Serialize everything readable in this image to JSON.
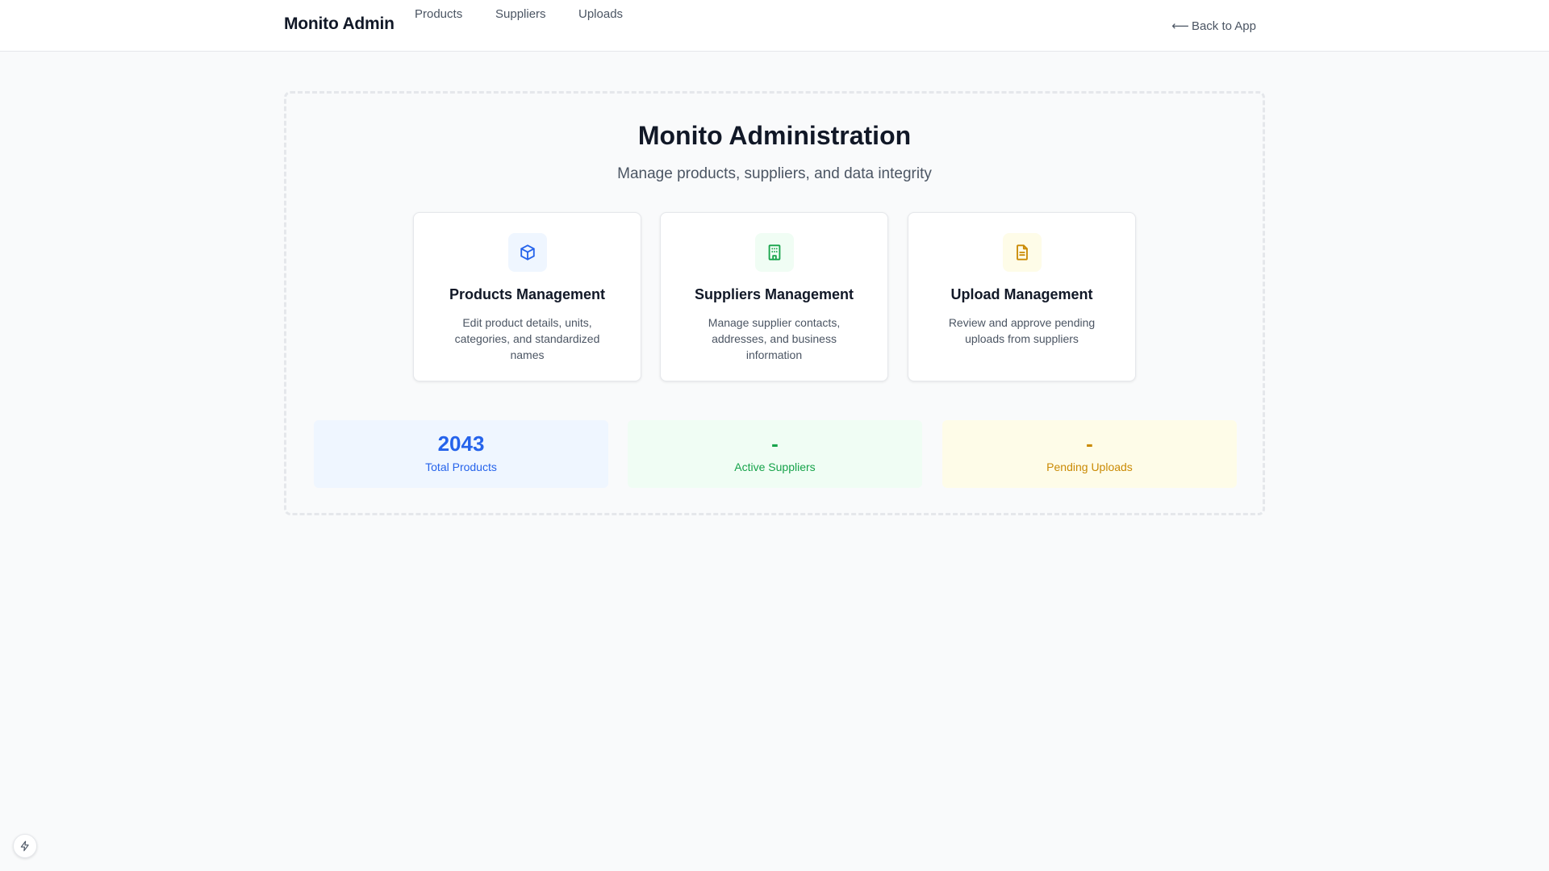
{
  "header": {
    "brand": "Monito Admin",
    "nav": [
      {
        "label": "Products"
      },
      {
        "label": "Suppliers"
      },
      {
        "label": "Uploads"
      }
    ],
    "back_link": "Back to App",
    "back_icon": "arrow-left-icon"
  },
  "main": {
    "title": "Monito Administration",
    "subtitle": "Manage products, suppliers, and data integrity",
    "cards": [
      {
        "icon": "cube-icon",
        "title": "Products Management",
        "description": "Edit product details, units, categories, and standardized names",
        "accent": "#2563eb"
      },
      {
        "icon": "building-icon",
        "title": "Suppliers Management",
        "description": "Manage supplier contacts, addresses, and business information",
        "accent": "#16a34a"
      },
      {
        "icon": "document-icon",
        "title": "Upload Management",
        "description": "Review and approve pending uploads from suppliers",
        "accent": "#ca8a04"
      }
    ],
    "stats": [
      {
        "value": "2043",
        "label": "Total Products",
        "color": "#2563eb"
      },
      {
        "value": "-",
        "label": "Active Suppliers",
        "color": "#16a34a"
      },
      {
        "value": "-",
        "label": "Pending Uploads",
        "color": "#ca8a04"
      }
    ]
  },
  "dev_badge": {
    "icon": "lightning-icon"
  }
}
